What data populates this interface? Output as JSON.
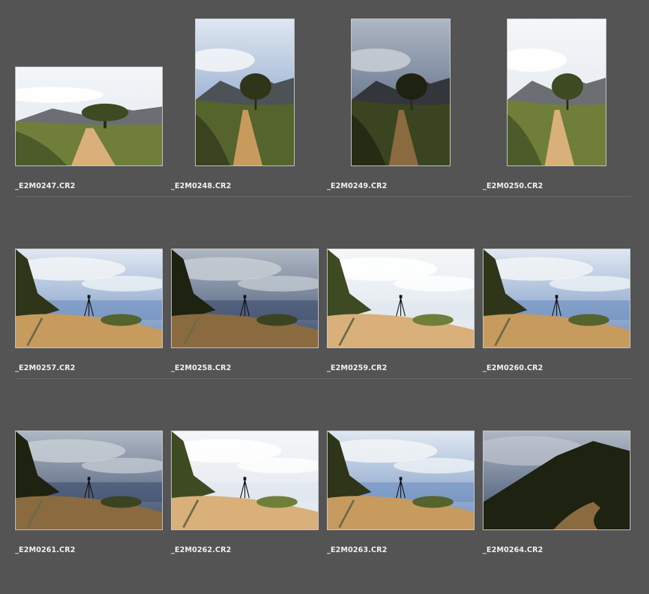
{
  "rows": [
    {
      "items": [
        {
          "filename": "_E2M0247.CR2",
          "orientation": "landscape",
          "scene": "trail",
          "tone": "bright"
        },
        {
          "filename": "_E2M0248.CR2",
          "orientation": "portrait",
          "scene": "trail",
          "tone": "normal"
        },
        {
          "filename": "_E2M0249.CR2",
          "orientation": "portrait",
          "scene": "trail",
          "tone": "dark"
        },
        {
          "filename": "_E2M0250.CR2",
          "orientation": "portrait",
          "scene": "trail",
          "tone": "bright"
        }
      ]
    },
    {
      "items": [
        {
          "filename": "_E2M0257.CR2",
          "orientation": "landscape",
          "scene": "tripod",
          "tone": "normal"
        },
        {
          "filename": "_E2M0258.CR2",
          "orientation": "landscape",
          "scene": "tripod",
          "tone": "dark"
        },
        {
          "filename": "_E2M0259.CR2",
          "orientation": "landscape",
          "scene": "tripod",
          "tone": "bright"
        },
        {
          "filename": "_E2M0260.CR2",
          "orientation": "landscape",
          "scene": "tripod",
          "tone": "normal"
        }
      ]
    },
    {
      "items": [
        {
          "filename": "_E2M0261.CR2",
          "orientation": "landscape",
          "scene": "tripod",
          "tone": "dark"
        },
        {
          "filename": "_E2M0262.CR2",
          "orientation": "landscape",
          "scene": "tripod",
          "tone": "bright"
        },
        {
          "filename": "_E2M0263.CR2",
          "orientation": "landscape",
          "scene": "tripod",
          "tone": "normal"
        },
        {
          "filename": "_E2M0264.CR2",
          "orientation": "landscape",
          "scene": "mountain",
          "tone": "dark"
        }
      ]
    }
  ]
}
